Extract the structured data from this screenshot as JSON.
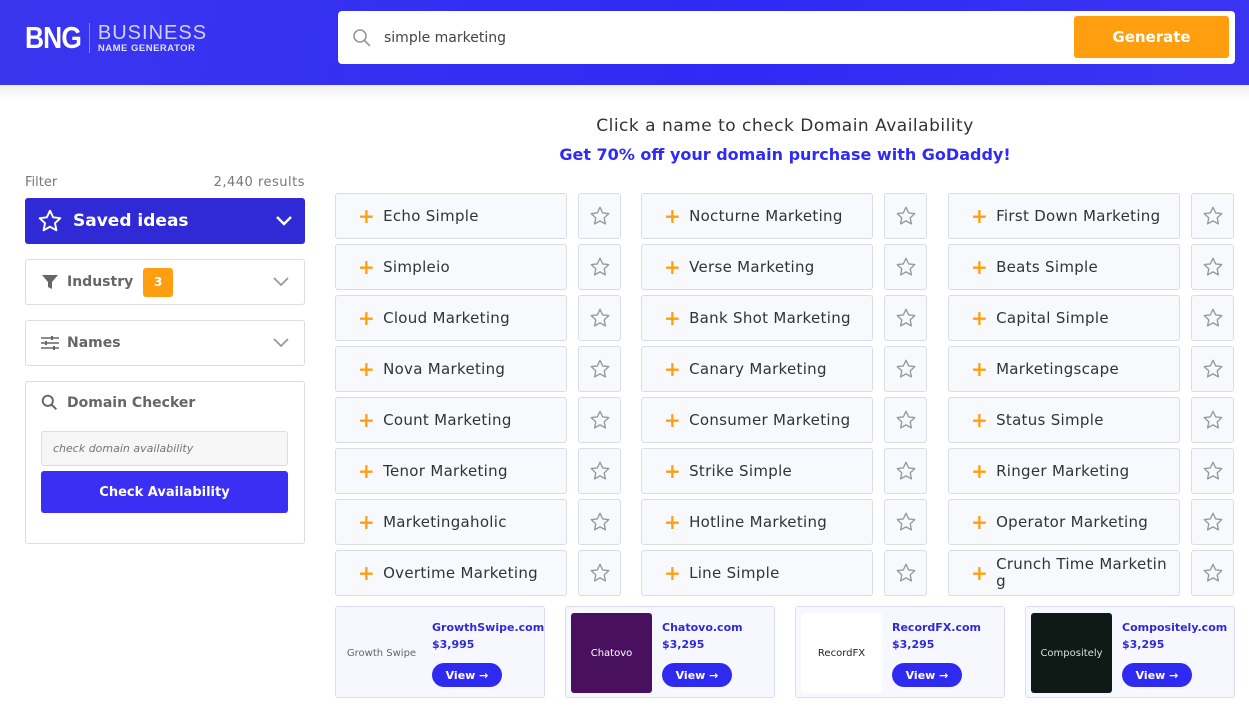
{
  "header": {
    "logo_mark": "BNG",
    "logo_line1": "BUSINESS",
    "logo_line2": "NAME GENERATOR",
    "search_value": "simple marketing",
    "generate_label": "Generate"
  },
  "main": {
    "headline": "Click a name to check Domain Availability",
    "promo": "Get 70% off your domain purchase with GoDaddy!"
  },
  "sidebar": {
    "filter_label": "Filter",
    "results": "2,440 results",
    "saved_label": "Saved ideas",
    "industry_label": "Industry",
    "industry_count": "3",
    "names_label": "Names",
    "domain_checker_label": "Domain Checker",
    "domain_placeholder": "check domain availability",
    "check_label": "Check Availability"
  },
  "names": [
    [
      "Echo Simple",
      "Nocturne Marketing",
      "First Down Marketing"
    ],
    [
      "Simpleio",
      "Verse Marketing",
      "Beats Simple"
    ],
    [
      "Cloud Marketing",
      "Bank Shot Marketing",
      "Capital Simple"
    ],
    [
      "Nova Marketing",
      "Canary Marketing",
      "Marketingscape"
    ],
    [
      "Count Marketing",
      "Consumer Marketing",
      "Status Simple"
    ],
    [
      "Tenor Marketing",
      "Strike Simple",
      "Ringer Marketing"
    ],
    [
      "Marketingaholic",
      "Hotline Marketing",
      "Operator Marketing"
    ],
    [
      "Overtime Marketing",
      "Line Simple",
      "Crunch Time Marketing"
    ]
  ],
  "ads": [
    {
      "logo": "Growth Swipe",
      "domain": "GrowthSwipe.com",
      "price": "$3,995",
      "view": "View →",
      "bg": "#f7f8ff",
      "fg": "#666"
    },
    {
      "logo": "Chatovo",
      "domain": "Chatovo.com",
      "price": "$3,295",
      "view": "View →",
      "bg": "#4a1060",
      "fg": "#fff"
    },
    {
      "logo": "RecordFX",
      "domain": "RecordFX.com",
      "price": "$3,295",
      "view": "View →",
      "bg": "#ffffff",
      "fg": "#222"
    },
    {
      "logo": "Compositely",
      "domain": "Compositely.com",
      "price": "$3,295",
      "view": "View →",
      "bg": "#0f1a17",
      "fg": "#ddd"
    }
  ],
  "colors": {
    "brand": "#2f2af5",
    "accent": "#ff9f0f"
  }
}
